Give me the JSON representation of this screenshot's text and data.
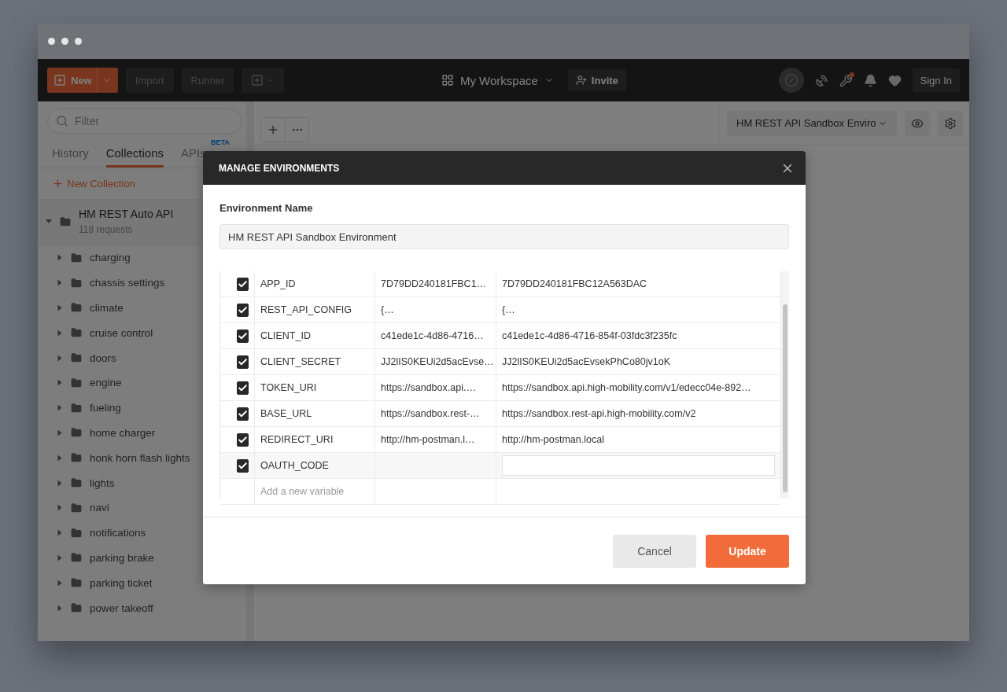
{
  "header": {
    "new_button": "New",
    "import_button": "Import",
    "runner_button": "Runner",
    "workspace": "My Workspace",
    "invite_button": "Invite",
    "sign_in_button": "Sign In"
  },
  "sidebar": {
    "filter_placeholder": "Filter",
    "tabs": [
      {
        "label": "History",
        "selected": false
      },
      {
        "label": "Collections",
        "selected": true
      },
      {
        "label": "APIs",
        "selected": false,
        "badge": "BETA"
      }
    ],
    "new_collection": "New Collection",
    "collection": {
      "name": "HM REST Auto API",
      "count": "118 requests",
      "expanded": true,
      "children": [
        {
          "name": "charging",
          "expanded": false
        },
        {
          "name": "chassis settings",
          "expanded": false
        },
        {
          "name": "climate",
          "expanded": false
        },
        {
          "name": "cruise control",
          "expanded": false
        },
        {
          "name": "doors",
          "expanded": false
        },
        {
          "name": "engine",
          "expanded": false
        },
        {
          "name": "fueling",
          "expanded": false
        },
        {
          "name": "home charger",
          "expanded": false
        },
        {
          "name": "honk horn flash lights",
          "expanded": false
        },
        {
          "name": "lights",
          "expanded": false
        },
        {
          "name": "navi",
          "expanded": false
        },
        {
          "name": "notifications",
          "expanded": false
        },
        {
          "name": "parking brake",
          "expanded": false
        },
        {
          "name": "parking ticket",
          "expanded": false
        },
        {
          "name": "power takeoff",
          "expanded": false
        }
      ]
    }
  },
  "environment_select": "HM REST API Sandbox Enviro",
  "modal": {
    "title": "MANAGE ENVIRONMENTS",
    "name_label": "Environment Name",
    "name_value": "HM REST API Sandbox Environment",
    "variables": [
      {
        "checked": true,
        "editing": false,
        "key": "APP_ID",
        "initial": "7D79DD240181FBC1…",
        "current": "7D79DD240181FBC12A563DAC"
      },
      {
        "checked": true,
        "editing": false,
        "key": "REST_API_CONFIG",
        "initial": "{…",
        "current": "{…"
      },
      {
        "checked": true,
        "editing": false,
        "key": "CLIENT_ID",
        "initial": "c41ede1c-4d86-4716…",
        "current": "c41ede1c-4d86-4716-854f-03fdc3f235fc"
      },
      {
        "checked": true,
        "editing": false,
        "key": "CLIENT_SECRET",
        "initial": "JJ2lIS0KEUi2d5acEvse…",
        "current": "JJ2lIS0KEUi2d5acEvsekPhCo80jv1oK"
      },
      {
        "checked": true,
        "editing": false,
        "key": "TOKEN_URI",
        "initial": "https://sandbox.api.…",
        "current": "https://sandbox.api.high-mobility.com/v1/edecc04e-892…"
      },
      {
        "checked": true,
        "editing": false,
        "key": "BASE_URL",
        "initial": "https://sandbox.rest-…",
        "current": "https://sandbox.rest-api.high-mobility.com/v2"
      },
      {
        "checked": true,
        "editing": false,
        "key": "REDIRECT_URI",
        "initial": "http://hm-postman.l…",
        "current": "http://hm-postman.local"
      },
      {
        "checked": true,
        "editing": true,
        "key": "OAUTH_CODE"
      }
    ],
    "new_variable_placeholder": "Add a new variable",
    "cancel_button": "Cancel",
    "update_button": "Update"
  }
}
